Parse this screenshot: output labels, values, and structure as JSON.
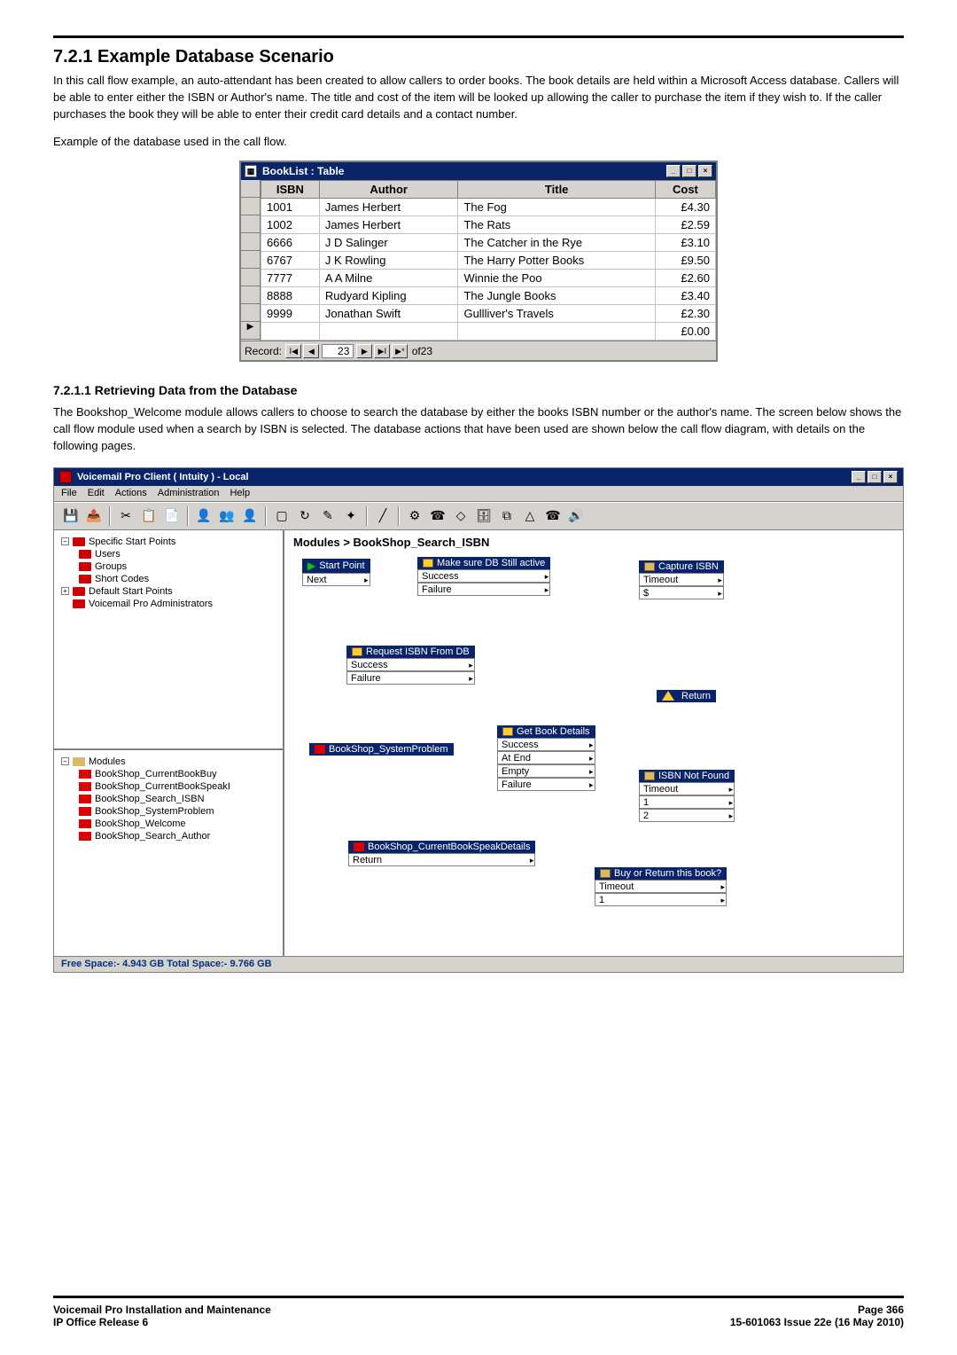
{
  "heading": "7.2.1 Example Database Scenario",
  "intro_p1": "In this call flow example, an auto-attendant has been created to allow callers to order books. The book details are held within a Microsoft Access database. Callers will be able to enter either the ISBN or Author's name. The title and cost of the item will be looked up allowing the caller to purchase the item if they wish to. If the caller purchases the book they will be able to enter their credit card details and a contact number.",
  "intro_p2": "Example of the database used in the call flow.",
  "db": {
    "title": "BookList : Table",
    "columns": [
      "ISBN",
      "Author",
      "Title",
      "Cost"
    ],
    "rows": [
      {
        "isbn": "1001",
        "author": "James Herbert",
        "title": "The Fog",
        "cost": "£4.30"
      },
      {
        "isbn": "1002",
        "author": "James Herbert",
        "title": "The Rats",
        "cost": "£2.59"
      },
      {
        "isbn": "6666",
        "author": "J D Salinger",
        "title": "The Catcher in the Rye",
        "cost": "£3.10"
      },
      {
        "isbn": "6767",
        "author": "J K Rowling",
        "title": "The Harry Potter Books",
        "cost": "£9.50"
      },
      {
        "isbn": "7777",
        "author": "A A Milne",
        "title": "Winnie the Poo",
        "cost": "£2.60"
      },
      {
        "isbn": "8888",
        "author": "Rudyard Kipling",
        "title": "The Jungle Books",
        "cost": "£3.40"
      },
      {
        "isbn": "9999",
        "author": "Jonathan Swift",
        "title": "Gullliver's Travels",
        "cost": "£2.30"
      },
      {
        "isbn": "",
        "author": "",
        "title": "",
        "cost": "£0.00"
      }
    ],
    "nav_label": "Record:",
    "nav_current": "23",
    "nav_total_prefix": "of ",
    "nav_total": "23"
  },
  "sub_heading": "7.2.1.1 Retrieving Data from the Database",
  "sub_p1": "The Bookshop_Welcome module allows callers to choose to search the database by either the books ISBN number or the author's name. The screen below shows the call flow module used when a search by ISBN is selected. The database actions that have been used are shown below the call flow diagram, with details on the following pages.",
  "vm": {
    "title": "Voicemail Pro Client    ( Intuity )  -    Local",
    "menu": [
      "File",
      "Edit",
      "Actions",
      "Administration",
      "Help"
    ],
    "tree_top": {
      "root": "Specific Start Points",
      "children": [
        "Users",
        "Groups",
        "Short Codes"
      ],
      "siblings": [
        "Default Start Points",
        "Voicemail Pro Administrators"
      ]
    },
    "tree_modules": {
      "root": "Modules",
      "children": [
        "BookShop_CurrentBookBuy",
        "BookShop_CurrentBookSpeakI",
        "BookShop_Search_ISBN",
        "BookShop_SystemProblem",
        "BookShop_Welcome",
        "BookShop_Search_Author"
      ]
    },
    "canvas_title": "Modules > BookShop_Search_ISBN",
    "nodes": {
      "start": {
        "title": "Start Point",
        "out": [
          "Next"
        ]
      },
      "makesure": {
        "title": "Make sure DB Still active",
        "out": [
          "Success",
          "Failure"
        ]
      },
      "capture": {
        "title": "Capture ISBN",
        "out": [
          "Timeout",
          "$"
        ]
      },
      "request": {
        "title": "Request ISBN From DB",
        "out": [
          "Success",
          "Failure"
        ]
      },
      "return": {
        "title": "Return"
      },
      "getbook": {
        "title": "Get Book Details",
        "out": [
          "Success",
          "At End",
          "Empty",
          "Failure"
        ]
      },
      "sysprob": {
        "title": "BookShop_SystemProblem"
      },
      "notfound": {
        "title": "ISBN Not Found",
        "out": [
          "Timeout",
          "1",
          "2"
        ]
      },
      "speakdet": {
        "title": "BookShop_CurrentBookSpeakDetails",
        "out": [
          "Return"
        ]
      },
      "buyreturn": {
        "title": "Buy or Return this book?",
        "out": [
          "Timeout",
          "1"
        ]
      }
    },
    "status": "Free Space:- 4.943 GB     Total Space:- 9.766 GB"
  },
  "footer": {
    "left1": "Voicemail Pro Installation and Maintenance",
    "right1": "Page 366",
    "left2": "IP Office Release 6",
    "right2": "15-601063 Issue 22e (16 May 2010)"
  }
}
